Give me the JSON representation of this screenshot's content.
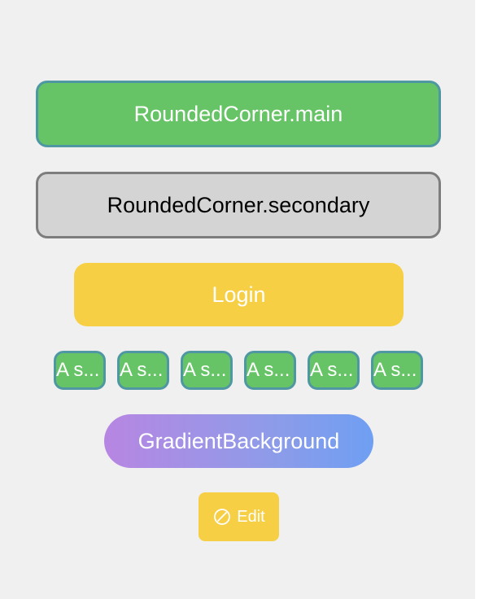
{
  "buttons": {
    "main": {
      "label": "RoundedCorner.main"
    },
    "secondary": {
      "label": "RoundedCorner.secondary"
    },
    "login": {
      "label": "Login"
    },
    "small": [
      {
        "label": "A s..."
      },
      {
        "label": "A s..."
      },
      {
        "label": "A s..."
      },
      {
        "label": "A s..."
      },
      {
        "label": "A s..."
      },
      {
        "label": "A s..."
      }
    ],
    "gradient": {
      "label": "GradientBackground"
    },
    "edit": {
      "label": "Edit",
      "icon": "slash-circle-icon"
    }
  },
  "colors": {
    "background": "#f0f0f0",
    "green": "#66c466",
    "green_border": "#4f97a3",
    "gray": "#d4d4d4",
    "gray_border": "#7d7d7d",
    "yellow": "#f6cf45",
    "gradient_start": "#b786e2",
    "gradient_end": "#6f9ff3",
    "text_light": "#ffffff",
    "text_dark": "#000000"
  }
}
